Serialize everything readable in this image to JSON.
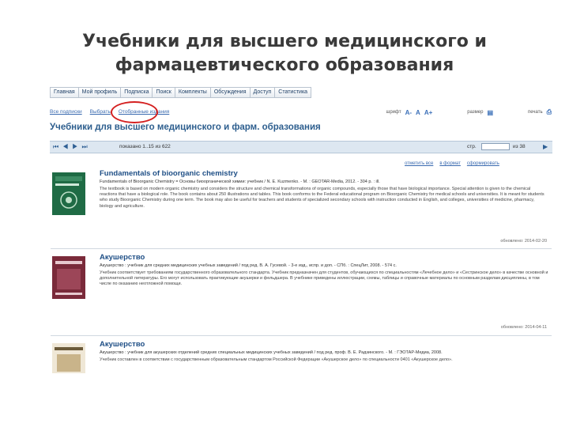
{
  "slide": {
    "title_line1": "Учебники для высшего медицинского и",
    "title_line2": "фармацевтического образования"
  },
  "topnav": [
    "Главная",
    "Мой профиль",
    "Подписка",
    "Поиск",
    "Комплекты",
    "Обсуждения",
    "Доступ",
    "Статистика"
  ],
  "subnav": [
    "Все подписки",
    "Выбрать",
    "Отобранные издания"
  ],
  "toolbar": {
    "font_label": "шрифт",
    "icons": [
      "A-",
      "A",
      "A+"
    ],
    "view_label": "размер",
    "print_label": "печать"
  },
  "page_title": "Учебники для высшего медицинского и фарм. образования",
  "pager": {
    "shown": "показано 1..15 из 622",
    "page_label": "стр.",
    "of_label": "из 38"
  },
  "list_tools": [
    "отметить все",
    "в формат",
    "сформировать"
  ],
  "colors": {
    "accent": "#2d5e8e",
    "highlight_circle": "#d42020",
    "pager_bg": "#dde7f1"
  },
  "books": [
    {
      "title": "Fundamentals of bioorganic chemistry",
      "bib": "Fundamentals of Bioorganic Chemistry = Основы биоорганической химии: учебник / N. E. Kuzmenko. - M. : GEOTAR-Media, 2012. - 304 p. : ill.",
      "desc": "The textbook is based on modern organic chemistry and considers the structure and chemical transformations of organic compounds, especially those that have biological importance. Special attention is given to the chemical reactions that have a biological role. The book contains about 250 illustrations and tables. This book conforms to the Federal educational program on Bioorganic Chemistry for medical schools and universities. It is meant for students who study Bioorganic Chemistry during one term. The book may also be useful for teachers and students of specialized secondary schools with instruction conducted in English, and colleges, universities of medicine, pharmacy, biology and agriculture.",
      "date": "обновлено: 2014-02-20"
    },
    {
      "title": "Акушерство",
      "bib": "Акушерство : учебник для средних медицинских учебных заведений / под ред. В. А. Гусевой. - 3-е изд., испр. и доп. - СПб. : СпецЛит, 2008. - 574 с.",
      "desc": "Учебник соответствует требованиям государственного образовательного стандарта. Учебник предназначен для студентов, обучающихся по специальностям «Лечебное дело» и «Сестринское дело» в качестве основной и дополнительной литературы. Его могут использовать практикующие акушерки и фельдшера. В учебнике приведены иллюстрации, схемы, таблицы и справочные материалы по основным разделам дисциплины, в том числе по оказанию неотложной помощи.",
      "date": "обновлено: 2014-04-11"
    },
    {
      "title": "Акушерство",
      "bib": "Акушерство : учебник для акушерских отделений средних специальных медицинских учебных заведений / под ред. проф. В. Е. Радзинского. - М. : ГЭОТАР-Медиа, 2008.",
      "desc": "Учебник составлен в соответствии с государственным образовательным стандартом Российской Федерации «Акушерское дело» по специальности 0401 «Акушерское дело».",
      "date": ""
    }
  ]
}
